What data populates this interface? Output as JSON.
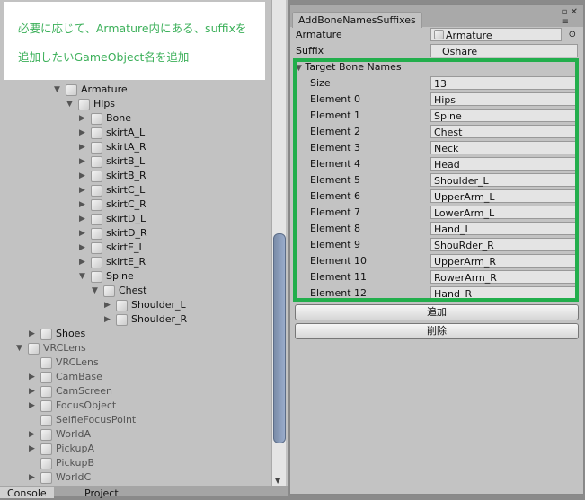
{
  "annotation": {
    "line1": "必要に応じて、Armature内にある、suffixを",
    "line2": "追加したいGameObject名を追加"
  },
  "hierarchy": [
    {
      "label": "Armature",
      "level": 0,
      "arrow": "down",
      "dim": false
    },
    {
      "label": "Hips",
      "level": 1,
      "arrow": "down",
      "dim": false
    },
    {
      "label": "Bone",
      "level": 2,
      "arrow": "right",
      "dim": false
    },
    {
      "label": "skirtA_L",
      "level": 2,
      "arrow": "right",
      "dim": false
    },
    {
      "label": "skirtA_R",
      "level": 2,
      "arrow": "right",
      "dim": false
    },
    {
      "label": "skirtB_L",
      "level": 2,
      "arrow": "right",
      "dim": false
    },
    {
      "label": "skirtB_R",
      "level": 2,
      "arrow": "right",
      "dim": false
    },
    {
      "label": "skirtC_L",
      "level": 2,
      "arrow": "right",
      "dim": false
    },
    {
      "label": "skirtC_R",
      "level": 2,
      "arrow": "right",
      "dim": false
    },
    {
      "label": "skirtD_L",
      "level": 2,
      "arrow": "right",
      "dim": false
    },
    {
      "label": "skirtD_R",
      "level": 2,
      "arrow": "right",
      "dim": false
    },
    {
      "label": "skirtE_L",
      "level": 2,
      "arrow": "right",
      "dim": false
    },
    {
      "label": "skirtE_R",
      "level": 2,
      "arrow": "right",
      "dim": false
    },
    {
      "label": "Spine",
      "level": 2,
      "arrow": "down",
      "dim": false
    },
    {
      "label": "Chest",
      "level": 3,
      "arrow": "down",
      "dim": false
    },
    {
      "label": "Shoulder_L",
      "level": 4,
      "arrow": "right",
      "dim": false
    },
    {
      "label": "Shoulder_R",
      "level": 4,
      "arrow": "right",
      "dim": false
    },
    {
      "label": "Shoes",
      "level": -2,
      "arrow": "right",
      "dim": false
    },
    {
      "label": "VRCLens",
      "level": -3,
      "arrow": "down",
      "dim": true
    },
    {
      "label": "VRCLens",
      "level": -2,
      "arrow": "",
      "dim": true
    },
    {
      "label": "CamBase",
      "level": -2,
      "arrow": "right",
      "dim": true
    },
    {
      "label": "CamScreen",
      "level": -2,
      "arrow": "right",
      "dim": true
    },
    {
      "label": "FocusObject",
      "level": -2,
      "arrow": "right",
      "dim": true
    },
    {
      "label": "SelfieFocusPoint",
      "level": -2,
      "arrow": "",
      "dim": true
    },
    {
      "label": "WorldA",
      "level": -2,
      "arrow": "right",
      "dim": true
    },
    {
      "label": "PickupA",
      "level": -2,
      "arrow": "right",
      "dim": true
    },
    {
      "label": "PickupB",
      "level": -2,
      "arrow": "",
      "dim": true
    },
    {
      "label": "WorldC",
      "level": -2,
      "arrow": "right",
      "dim": true
    }
  ],
  "bottom_tabs": {
    "console": "Console",
    "project": "Project"
  },
  "window": {
    "tab": "AddBoneNamesSuffixes",
    "armature_label": "Armature",
    "armature_value": "Armature",
    "suffix_label": "Suffix",
    "suffix_value": "Oshare",
    "target_label": "Target Bone Names",
    "size_label": "Size",
    "size_value": "13",
    "elements": [
      {
        "label": "Element 0",
        "value": "Hips"
      },
      {
        "label": "Element 1",
        "value": "Spine"
      },
      {
        "label": "Element 2",
        "value": "Chest"
      },
      {
        "label": "Element 3",
        "value": "Neck"
      },
      {
        "label": "Element 4",
        "value": "Head"
      },
      {
        "label": "Element 5",
        "value": "Shoulder_L"
      },
      {
        "label": "Element 6",
        "value": "UpperArm_L"
      },
      {
        "label": "Element 7",
        "value": "LowerArm_L"
      },
      {
        "label": "Element 8",
        "value": "Hand_L"
      },
      {
        "label": "Element 9",
        "value": "ShouRder_R"
      },
      {
        "label": "Element 10",
        "value": "UpperArm_R"
      },
      {
        "label": "Element 11",
        "value": "RowerArm_R"
      },
      {
        "label": "Element 12",
        "value": "Hand_R"
      }
    ],
    "add_button": "追加",
    "remove_button": "削除"
  },
  "colors": {
    "highlight": "#22ae4c",
    "annotation_text": "#3cb05a"
  }
}
